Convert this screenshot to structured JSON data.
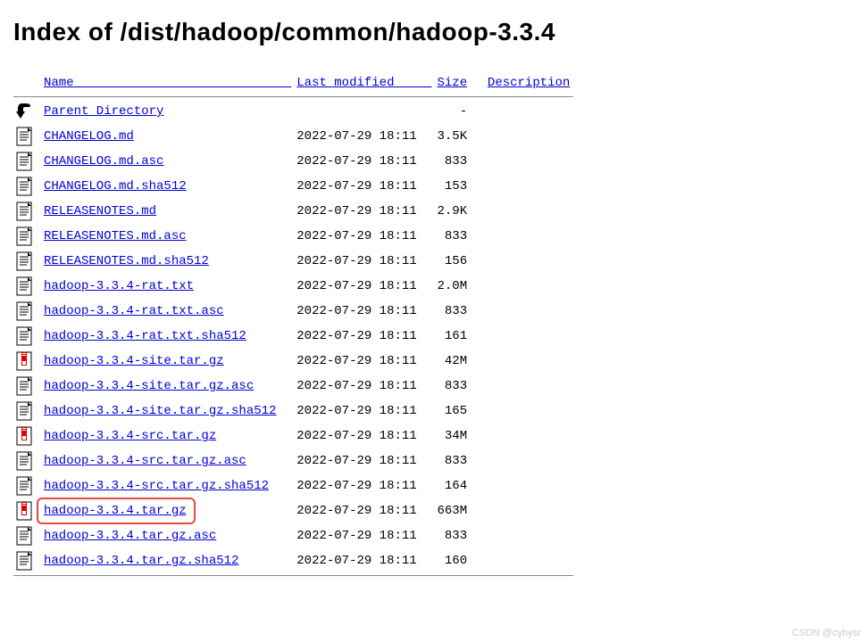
{
  "title": "Index of /dist/hadoop/common/hadoop-3.3.4",
  "columns": {
    "name": "Name",
    "modified": "Last modified",
    "size": "Size",
    "description": "Description"
  },
  "name_col_width": 33,
  "modified_col_width": 18,
  "size_col_width": 6,
  "entries": [
    {
      "icon": "back",
      "name": "Parent Directory",
      "modified": "",
      "size": "-",
      "highlight": false
    },
    {
      "icon": "text",
      "name": "CHANGELOG.md",
      "modified": "2022-07-29 18:11",
      "size": "3.5K",
      "highlight": false
    },
    {
      "icon": "text",
      "name": "CHANGELOG.md.asc",
      "modified": "2022-07-29 18:11",
      "size": "833",
      "highlight": false
    },
    {
      "icon": "text",
      "name": "CHANGELOG.md.sha512",
      "modified": "2022-07-29 18:11",
      "size": "153",
      "highlight": false
    },
    {
      "icon": "text",
      "name": "RELEASENOTES.md",
      "modified": "2022-07-29 18:11",
      "size": "2.9K",
      "highlight": false
    },
    {
      "icon": "text",
      "name": "RELEASENOTES.md.asc",
      "modified": "2022-07-29 18:11",
      "size": "833",
      "highlight": false
    },
    {
      "icon": "text",
      "name": "RELEASENOTES.md.sha512",
      "modified": "2022-07-29 18:11",
      "size": "156",
      "highlight": false
    },
    {
      "icon": "text",
      "name": "hadoop-3.3.4-rat.txt",
      "modified": "2022-07-29 18:11",
      "size": "2.0M",
      "highlight": false
    },
    {
      "icon": "text",
      "name": "hadoop-3.3.4-rat.txt.asc",
      "modified": "2022-07-29 18:11",
      "size": "833",
      "highlight": false
    },
    {
      "icon": "text",
      "name": "hadoop-3.3.4-rat.txt.sha512",
      "modified": "2022-07-29 18:11",
      "size": "161",
      "highlight": false
    },
    {
      "icon": "archive",
      "name": "hadoop-3.3.4-site.tar.gz",
      "modified": "2022-07-29 18:11",
      "size": " 42M",
      "highlight": false
    },
    {
      "icon": "text",
      "name": "hadoop-3.3.4-site.tar.gz.asc",
      "modified": "2022-07-29 18:11",
      "size": "833",
      "highlight": false
    },
    {
      "icon": "text",
      "name": "hadoop-3.3.4-site.tar.gz.sha512",
      "modified": "2022-07-29 18:11",
      "size": "165",
      "highlight": false
    },
    {
      "icon": "archive",
      "name": "hadoop-3.3.4-src.tar.gz",
      "modified": "2022-07-29 18:11",
      "size": " 34M",
      "highlight": false
    },
    {
      "icon": "text",
      "name": "hadoop-3.3.4-src.tar.gz.asc",
      "modified": "2022-07-29 18:11",
      "size": "833",
      "highlight": false
    },
    {
      "icon": "text",
      "name": "hadoop-3.3.4-src.tar.gz.sha512",
      "modified": "2022-07-29 18:11",
      "size": "164",
      "highlight": false
    },
    {
      "icon": "archive",
      "name": "hadoop-3.3.4.tar.gz",
      "modified": "2022-07-29 18:11",
      "size": "663M",
      "highlight": true
    },
    {
      "icon": "text",
      "name": "hadoop-3.3.4.tar.gz.asc",
      "modified": "2022-07-29 18:11",
      "size": "833",
      "highlight": false
    },
    {
      "icon": "text",
      "name": "hadoop-3.3.4.tar.gz.sha512",
      "modified": "2022-07-29 18:11",
      "size": "160",
      "highlight": false
    }
  ],
  "watermark": "CSDN @cyhysr"
}
